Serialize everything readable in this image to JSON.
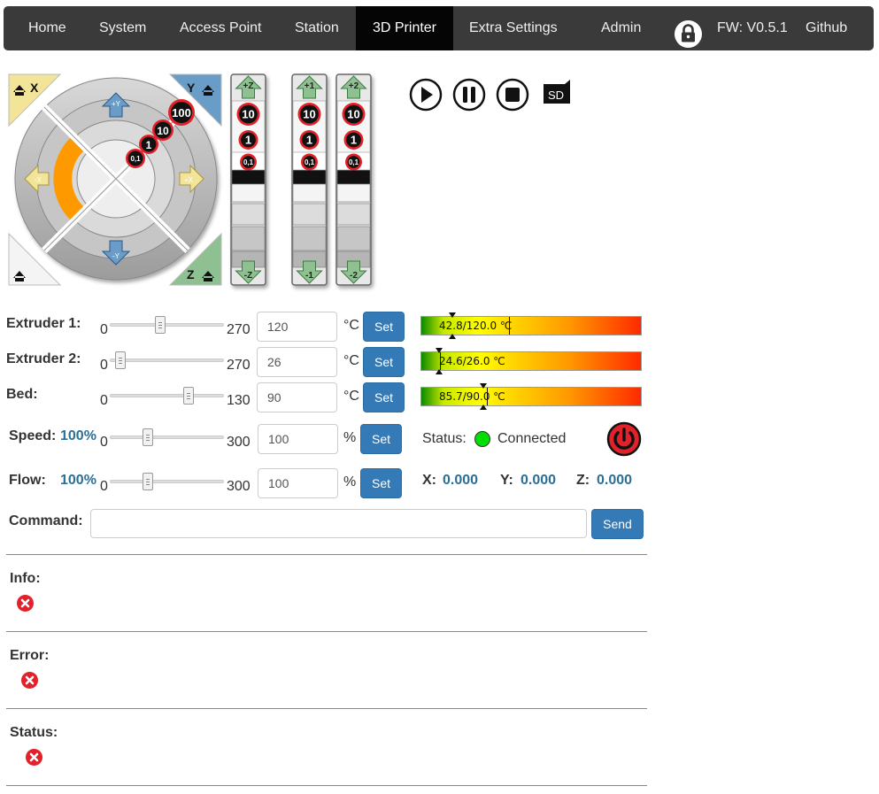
{
  "nav": {
    "home": "Home",
    "system": "System",
    "access_point": "Access Point",
    "station": "Station",
    "printer": "3D Printer",
    "extra": "Extra Settings",
    "admin": "Admin",
    "fw": "FW: V0.5.1",
    "github": "Github"
  },
  "jog": {
    "x": "X",
    "y": "Y",
    "z": "Z",
    "plus_y": "+Y",
    "minus_y": "-Y",
    "plus_x": "+X",
    "minus_x": "-X",
    "steps": [
      "100",
      "10",
      "1",
      "0,1"
    ],
    "z_top": "+Z",
    "z_bottom": "-Z",
    "e1_top": "+1",
    "e1_bottom": "-1",
    "e2_top": "+2",
    "e2_bottom": "-2",
    "ten": "10",
    "one": "1",
    "tenth": "0,1"
  },
  "controls": {
    "sd": "SD"
  },
  "extruder1": {
    "label": "Extruder 1:",
    "min": "0",
    "max": "270",
    "value": "120",
    "unit": "°C",
    "set": "Set",
    "level": 0.444,
    "temp": "42.8/120.0 ℃",
    "current": 42.8,
    "target": 120.0
  },
  "extruder2": {
    "label": "Extruder 2:",
    "min": "0",
    "max": "270",
    "value": "26",
    "unit": "°C",
    "set": "Set",
    "level": 0.096,
    "temp": "24.6/26.0 ℃",
    "current": 24.6,
    "target": 26.0
  },
  "bed": {
    "label": "Bed:",
    "min": "0",
    "max": "130",
    "value": "90",
    "unit": "°C",
    "set": "Set",
    "level": 0.692,
    "temp": "85.7/90.0 ℃",
    "current": 85.7,
    "target": 90.0
  },
  "speed": {
    "label": "Speed:",
    "pct": "100%",
    "min": "0",
    "max": "300",
    "value": "100",
    "unit": "%",
    "set": "Set",
    "level": 0.333
  },
  "flow": {
    "label": "Flow:",
    "pct": "100%",
    "min": "0",
    "max": "300",
    "value": "100",
    "unit": "%",
    "set": "Set",
    "level": 0.333
  },
  "status": {
    "label": "Status:",
    "text": "Connected",
    "color": "#00dd00"
  },
  "pos": {
    "x_label": "X:",
    "x": "0.000",
    "y_label": "Y:",
    "y": "0.000",
    "z_label": "Z:",
    "z": "0.000"
  },
  "command": {
    "label": "Command:",
    "value": "",
    "send": "Send"
  },
  "logs": {
    "info": "Info:",
    "error": "Error:",
    "status": "Status:"
  },
  "colors": {
    "accent": "#337ab7",
    "value_text": "#2a6f96",
    "nav_bg": "#3a3a3a",
    "danger": "#e2222a"
  }
}
